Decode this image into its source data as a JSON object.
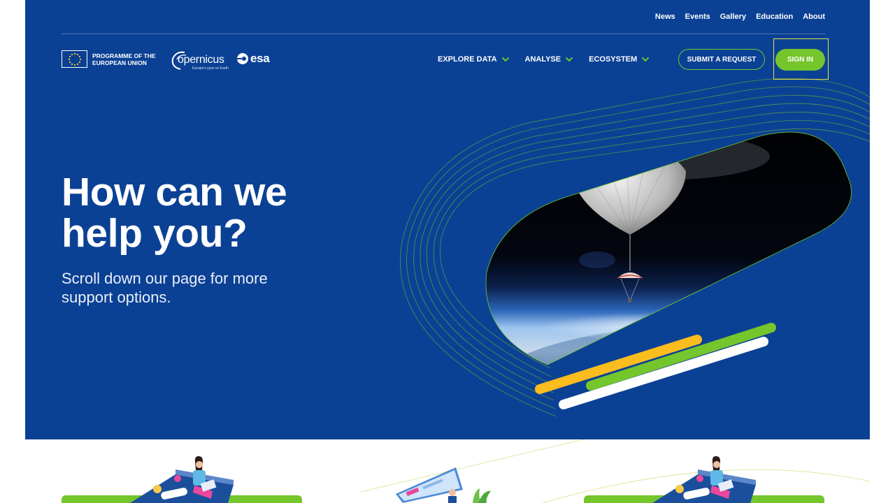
{
  "top_nav": {
    "links": [
      "News",
      "Events",
      "Gallery",
      "Education",
      "About"
    ]
  },
  "logos": {
    "eu_programme": "PROGRAMME OF THE EUROPEAN UNION",
    "copernicus_word": "opernicus",
    "copernicus_tagline": "Europe's eyes on Earth",
    "esa_word": "esa"
  },
  "main_nav": {
    "items": [
      {
        "label": "EXPLORE DATA",
        "icon": "chevron-down-icon"
      },
      {
        "label": "ANALYSE",
        "icon": "chevron-down-icon"
      },
      {
        "label": "ECOSYSTEM",
        "icon": "chevron-down-icon"
      }
    ]
  },
  "actions": {
    "submit_request": "SUBMIT A REQUEST",
    "sign_in": "SIGN IN"
  },
  "hero": {
    "title_line1": "How can we",
    "title_line2": "help you?",
    "subtitle": "Scroll down our page for more support options."
  },
  "colors": {
    "hero_bg": "#0b4194",
    "accent_green": "#75c52c",
    "accent_yellow": "#fbbc1e",
    "focus_outline": "#e6e04a",
    "white": "#ffffff"
  }
}
